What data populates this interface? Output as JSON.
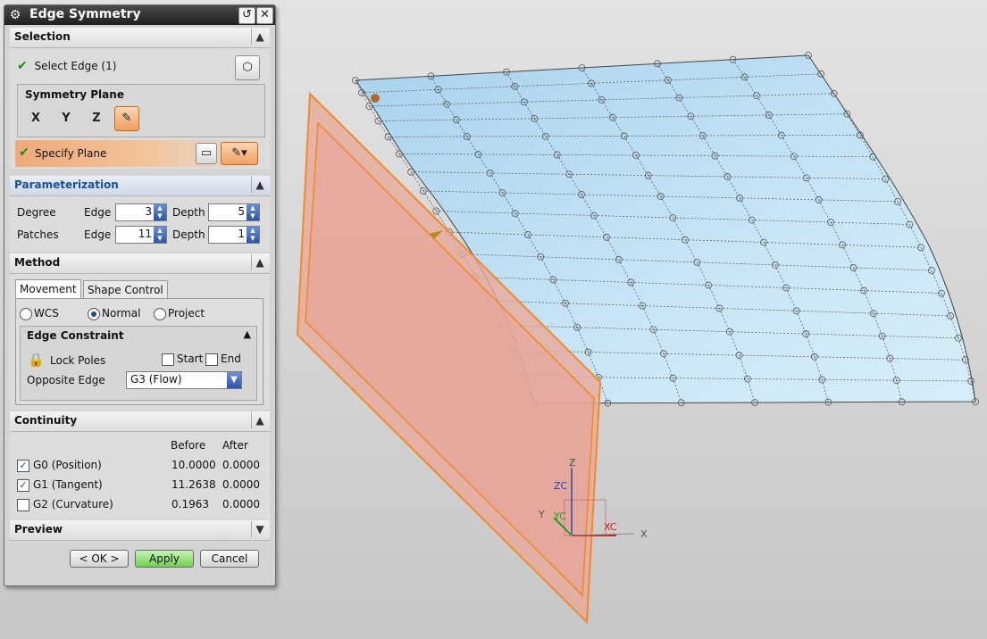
{
  "dialog": {
    "title": "Edge Symmetry",
    "title_buttons": {
      "reset": "↺",
      "close": "✕"
    }
  },
  "selection": {
    "header": "Selection",
    "select_edge": "Select Edge (1)",
    "symmetry_plane_label": "Symmetry Plane",
    "plane_buttons": [
      "X",
      "Y",
      "Z",
      ""
    ],
    "specify_plane": "Specify Plane"
  },
  "parameterization": {
    "header": "Parameterization",
    "degree_label": "Degree",
    "patches_label": "Patches",
    "edge_label": "Edge",
    "depth_label": "Depth",
    "degree_edge": "3",
    "degree_depth": "5",
    "patches_edge": "11",
    "patches_depth": "1"
  },
  "method": {
    "header": "Method",
    "tabs": [
      "Movement",
      "Shape Control"
    ],
    "radios": [
      "WCS",
      "Normal",
      "Project"
    ],
    "selected_radio": "Normal",
    "edge_constraint_label": "Edge Constraint",
    "lock_poles": "Lock Poles",
    "start": "Start",
    "end": "End",
    "opposite_edge_label": "Opposite Edge",
    "opposite_edge_value": "G3 (Flow)"
  },
  "continuity": {
    "header": "Continuity",
    "col_before": "Before",
    "col_after": "After",
    "rows": [
      {
        "label": "G0 (Position)",
        "before": "10.0000",
        "after": "0.0000",
        "checked": true
      },
      {
        "label": "G1 (Tangent)",
        "before": "11.2638",
        "after": "0.0000",
        "checked": true
      },
      {
        "label": "G2 (Curvature)",
        "before": "0.1963",
        "after": "0.0000",
        "checked": false
      }
    ]
  },
  "preview": {
    "header": "Preview"
  },
  "buttons": {
    "ok": "< OK >",
    "apply": "Apply",
    "cancel": "Cancel"
  },
  "viewport": {
    "axis_labels": {
      "z": "Z",
      "zc": "ZC",
      "y": "Y",
      "yc": "YC",
      "xc": "XC",
      "x": "X"
    },
    "colors": {
      "surface": "#b9dcf2",
      "plane": "#e8a99a",
      "plane_border": "#f08a2a"
    }
  }
}
